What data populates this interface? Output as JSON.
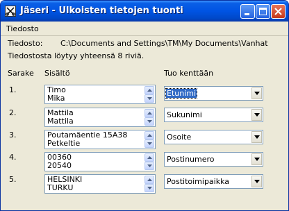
{
  "window": {
    "title": "Jäseri - Ulkoisten tietojen tuonti"
  },
  "menu": {
    "file": "Tiedosto"
  },
  "file_info": {
    "label": "Tiedosto:",
    "path": "C:\\Documents and Settings\\TM\\My Documents\\Vanhat",
    "summary": "Tiedostosta löytyy yhteensä 8 riviä."
  },
  "headers": {
    "column": "Sarake",
    "content": "Sisältö",
    "target": "Tuo kenttään"
  },
  "rows": [
    {
      "num": "1.",
      "line1": "Timo",
      "line2": "Mika",
      "field": "Etunimi",
      "selected": true
    },
    {
      "num": "2.",
      "line1": "Mattila",
      "line2": "Mattila",
      "field": "Sukunimi",
      "selected": false
    },
    {
      "num": "3.",
      "line1": "Poutamäentie 15A38",
      "line2": "Petkeltie",
      "field": "Osoite",
      "selected": false
    },
    {
      "num": "4.",
      "line1": "00360",
      "line2": "20540",
      "field": "Postinumero",
      "selected": false
    },
    {
      "num": "5.",
      "line1": "HELSINKI",
      "line2": "TURKU",
      "field": "Postitoimipaikka",
      "selected": false
    }
  ],
  "icons": {
    "app": "scissors-icon",
    "minimize": "minimize-icon",
    "maximize": "maximize-icon",
    "close": "close-icon",
    "scroll_up": "scroll-up-arrow-icon",
    "scroll_down": "scroll-down-arrow-icon",
    "dropdown": "dropdown-arrow-icon"
  },
  "colors": {
    "titlebar": "#0054e3",
    "selection": "#316ac5",
    "window_bg": "#ece9d8"
  }
}
